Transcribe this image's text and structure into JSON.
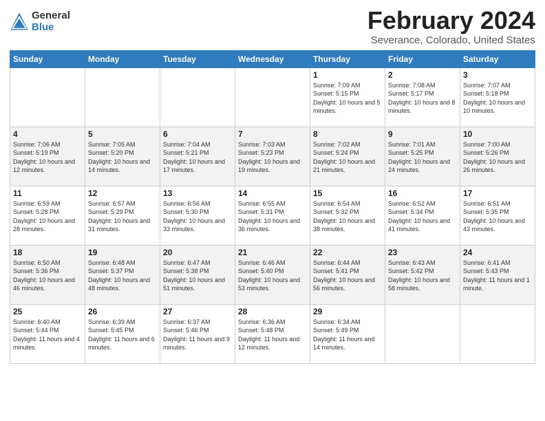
{
  "header": {
    "logo_line1": "General",
    "logo_line2": "Blue",
    "title": "February 2024",
    "subtitle": "Severance, Colorado, United States"
  },
  "days_of_week": [
    "Sunday",
    "Monday",
    "Tuesday",
    "Wednesday",
    "Thursday",
    "Friday",
    "Saturday"
  ],
  "weeks": [
    [
      {
        "day": "",
        "info": ""
      },
      {
        "day": "",
        "info": ""
      },
      {
        "day": "",
        "info": ""
      },
      {
        "day": "",
        "info": ""
      },
      {
        "day": "1",
        "info": "Sunrise: 7:09 AM\nSunset: 5:15 PM\nDaylight: 10 hours\nand 5 minutes."
      },
      {
        "day": "2",
        "info": "Sunrise: 7:08 AM\nSunset: 5:17 PM\nDaylight: 10 hours\nand 8 minutes."
      },
      {
        "day": "3",
        "info": "Sunrise: 7:07 AM\nSunset: 5:18 PM\nDaylight: 10 hours\nand 10 minutes."
      }
    ],
    [
      {
        "day": "4",
        "info": "Sunrise: 7:06 AM\nSunset: 5:19 PM\nDaylight: 10 hours\nand 12 minutes."
      },
      {
        "day": "5",
        "info": "Sunrise: 7:05 AM\nSunset: 5:20 PM\nDaylight: 10 hours\nand 14 minutes."
      },
      {
        "day": "6",
        "info": "Sunrise: 7:04 AM\nSunset: 5:21 PM\nDaylight: 10 hours\nand 17 minutes."
      },
      {
        "day": "7",
        "info": "Sunrise: 7:03 AM\nSunset: 5:23 PM\nDaylight: 10 hours\nand 19 minutes."
      },
      {
        "day": "8",
        "info": "Sunrise: 7:02 AM\nSunset: 5:24 PM\nDaylight: 10 hours\nand 21 minutes."
      },
      {
        "day": "9",
        "info": "Sunrise: 7:01 AM\nSunset: 5:25 PM\nDaylight: 10 hours\nand 24 minutes."
      },
      {
        "day": "10",
        "info": "Sunrise: 7:00 AM\nSunset: 5:26 PM\nDaylight: 10 hours\nand 26 minutes."
      }
    ],
    [
      {
        "day": "11",
        "info": "Sunrise: 6:59 AM\nSunset: 5:28 PM\nDaylight: 10 hours\nand 28 minutes."
      },
      {
        "day": "12",
        "info": "Sunrise: 6:57 AM\nSunset: 5:29 PM\nDaylight: 10 hours\nand 31 minutes."
      },
      {
        "day": "13",
        "info": "Sunrise: 6:56 AM\nSunset: 5:30 PM\nDaylight: 10 hours\nand 33 minutes."
      },
      {
        "day": "14",
        "info": "Sunrise: 6:55 AM\nSunset: 5:31 PM\nDaylight: 10 hours\nand 36 minutes."
      },
      {
        "day": "15",
        "info": "Sunrise: 6:54 AM\nSunset: 5:32 PM\nDaylight: 10 hours\nand 38 minutes."
      },
      {
        "day": "16",
        "info": "Sunrise: 6:52 AM\nSunset: 5:34 PM\nDaylight: 10 hours\nand 41 minutes."
      },
      {
        "day": "17",
        "info": "Sunrise: 6:51 AM\nSunset: 5:35 PM\nDaylight: 10 hours\nand 43 minutes."
      }
    ],
    [
      {
        "day": "18",
        "info": "Sunrise: 6:50 AM\nSunset: 5:36 PM\nDaylight: 10 hours\nand 46 minutes."
      },
      {
        "day": "19",
        "info": "Sunrise: 6:48 AM\nSunset: 5:37 PM\nDaylight: 10 hours\nand 48 minutes."
      },
      {
        "day": "20",
        "info": "Sunrise: 6:47 AM\nSunset: 5:38 PM\nDaylight: 10 hours\nand 51 minutes."
      },
      {
        "day": "21",
        "info": "Sunrise: 6:46 AM\nSunset: 5:40 PM\nDaylight: 10 hours\nand 53 minutes."
      },
      {
        "day": "22",
        "info": "Sunrise: 6:44 AM\nSunset: 5:41 PM\nDaylight: 10 hours\nand 56 minutes."
      },
      {
        "day": "23",
        "info": "Sunrise: 6:43 AM\nSunset: 5:42 PM\nDaylight: 10 hours\nand 58 minutes."
      },
      {
        "day": "24",
        "info": "Sunrise: 6:41 AM\nSunset: 5:43 PM\nDaylight: 11 hours\nand 1 minute."
      }
    ],
    [
      {
        "day": "25",
        "info": "Sunrise: 6:40 AM\nSunset: 5:44 PM\nDaylight: 11 hours\nand 4 minutes."
      },
      {
        "day": "26",
        "info": "Sunrise: 6:39 AM\nSunset: 5:45 PM\nDaylight: 11 hours\nand 6 minutes."
      },
      {
        "day": "27",
        "info": "Sunrise: 6:37 AM\nSunset: 5:46 PM\nDaylight: 11 hours\nand 9 minutes."
      },
      {
        "day": "28",
        "info": "Sunrise: 6:36 AM\nSunset: 5:48 PM\nDaylight: 11 hours\nand 12 minutes."
      },
      {
        "day": "29",
        "info": "Sunrise: 6:34 AM\nSunset: 5:49 PM\nDaylight: 11 hours\nand 14 minutes."
      },
      {
        "day": "",
        "info": ""
      },
      {
        "day": "",
        "info": ""
      }
    ]
  ]
}
